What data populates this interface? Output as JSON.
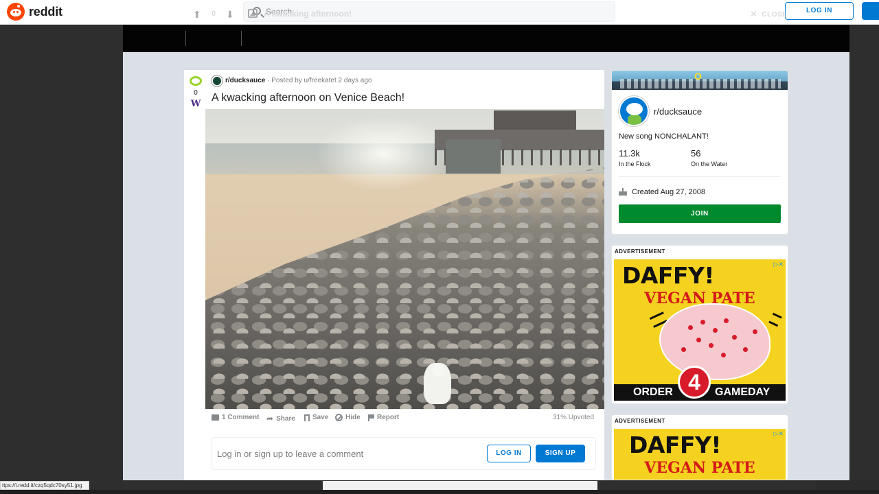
{
  "header": {
    "logo_text": "reddit",
    "search_placeholder": "Search",
    "login_label": "LOG IN"
  },
  "post_bar": {
    "score": "0",
    "title": "A kwacking afternoon!",
    "close_label": "CLOSE"
  },
  "post": {
    "vote_score": "0",
    "vote_flair_letter": "W",
    "subreddit": "r/ducksauce",
    "posted_by": "Posted by u/freekatet 2 days ago",
    "title": "A kwacking afternoon on Venice Beach!",
    "actions": {
      "comments": "1 Comment",
      "share": "Share",
      "save": "Save",
      "hide": "Hide",
      "report": "Report"
    },
    "upvoted": "31% Upvoted"
  },
  "comment_box": {
    "prompt": "Log in or sign up to leave a comment",
    "login_label": "LOG IN",
    "signup_label": "SIGN UP"
  },
  "community": {
    "banner_letter": "O",
    "name": "r/ducksauce",
    "description": "New song NONCHALANT!",
    "members_value": "11.3k",
    "members_label": "In the Flock",
    "online_value": "56",
    "online_label": "On the Water",
    "created": "Created Aug 27, 2008",
    "join_label": "JOIN"
  },
  "ads": [
    {
      "label": "ADVERTISEMENT",
      "headline": "DAFFY!",
      "subhead": "VEGAN PATE",
      "left_text": "ORDER",
      "number": "4",
      "right_text": "GAMEDAY"
    },
    {
      "label": "ADVERTISEMENT",
      "headline": "DAFFY!",
      "subhead": "VEGAN PATE"
    }
  ],
  "status_url": "ttps://i.redd.it/czq5qdc70sy51.jpg",
  "colors": {
    "reddit_orange": "#ff4500",
    "link_blue": "#0079d3",
    "join_green": "#008a2e",
    "ad_yellow": "#f4d21f",
    "ad_red": "#d41a1a"
  }
}
